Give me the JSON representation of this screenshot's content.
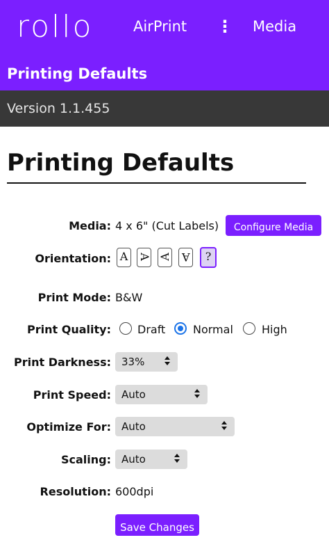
{
  "topbar": {
    "logo_text": "rollo",
    "nav": [
      {
        "label": "AirPrint"
      },
      {
        "label": "⋮"
      },
      {
        "label": "Media"
      }
    ],
    "background": "#7b1fff"
  },
  "subbar": {
    "title": "Printing Defaults"
  },
  "version": {
    "text": "Version 1.1.455"
  },
  "page": {
    "title": "Printing Defaults"
  },
  "accent_color": "#7b1fff",
  "form": {
    "media": {
      "label": "Media:",
      "value": "4 x 6\" (Cut Labels)",
      "button": "Configure Media"
    },
    "orientation": {
      "label": "Orientation:",
      "options": [
        {
          "glyph": "A",
          "icon": "orientation-portrait-icon"
        },
        {
          "glyph": "A",
          "icon": "orientation-rotate-left-icon"
        },
        {
          "glyph": "A",
          "icon": "orientation-rotate-right-icon"
        },
        {
          "glyph": "A",
          "icon": "orientation-upside-down-icon"
        },
        {
          "glyph": "?",
          "icon": "orientation-auto-icon",
          "selected": true
        }
      ]
    },
    "print_mode": {
      "label": "Print Mode:",
      "value": "B&W"
    },
    "print_quality": {
      "label": "Print Quality:",
      "options": [
        "Draft",
        "Normal",
        "High"
      ],
      "selected": "Normal"
    },
    "print_darkness": {
      "label": "Print Darkness:",
      "value": "33%"
    },
    "print_speed": {
      "label": "Print Speed:",
      "value": "Auto"
    },
    "optimize_for": {
      "label": "Optimize For:",
      "value": "Auto"
    },
    "scaling": {
      "label": "Scaling:",
      "value": "Auto"
    },
    "resolution": {
      "label": "Resolution:",
      "value": "600dpi"
    },
    "save_button": "Save Changes"
  }
}
